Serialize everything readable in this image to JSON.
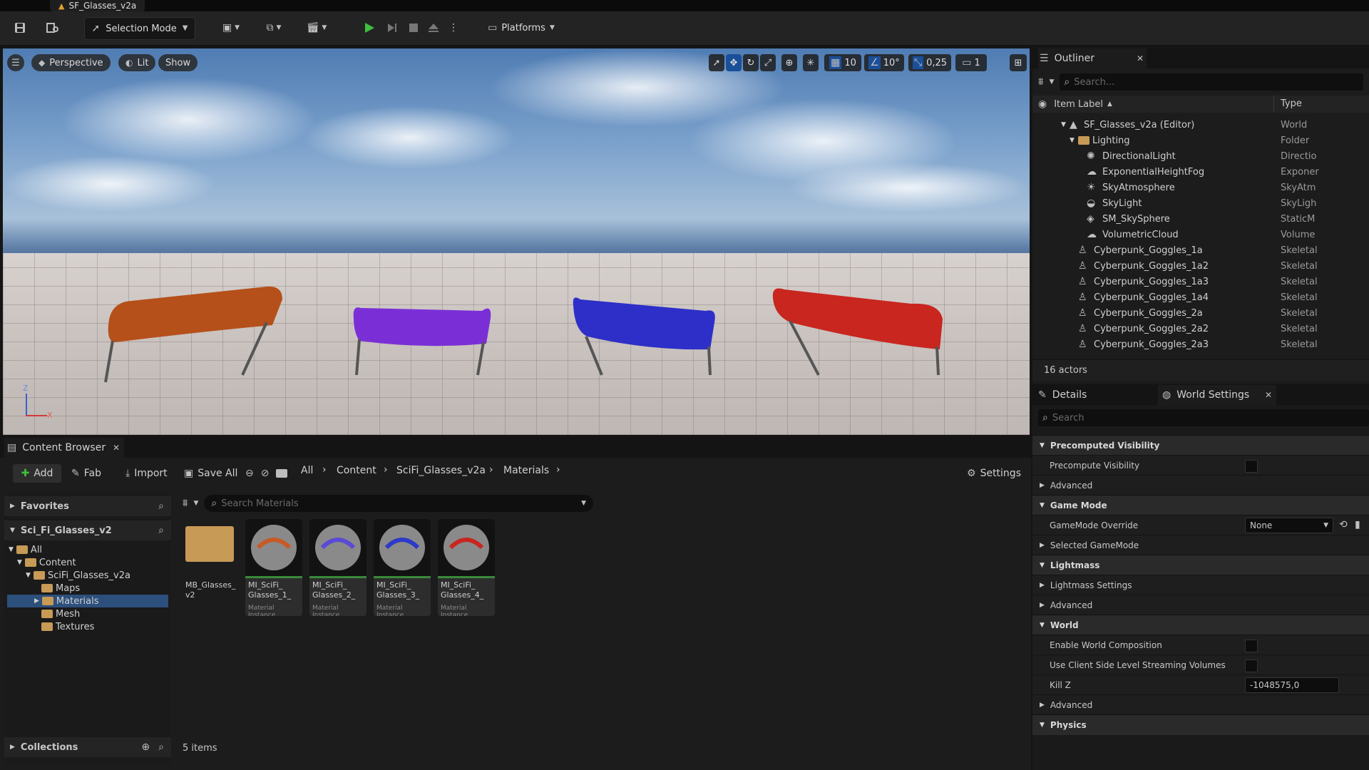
{
  "document": {
    "tab_title": "SF_Glasses_v2a"
  },
  "toolbar": {
    "mode_label": "Selection Mode",
    "platforms_label": "Platforms"
  },
  "viewport": {
    "perspective_label": "Perspective",
    "lit_label": "Lit",
    "show_label": "Show",
    "grid_snap": "10",
    "rotation_snap": "10°",
    "scale_snap": "0,25",
    "camera_speed": "1",
    "axis_z": "Z",
    "axis_x": "X",
    "glasses_colors": [
      "#b5501a",
      "#7a2fd6",
      "#2d2fc8",
      "#c8261f"
    ]
  },
  "outliner": {
    "tab_label": "Outliner",
    "search_placeholder": "Search...",
    "col_label": "Item Label",
    "col_type": "Type",
    "rows": [
      {
        "label": "SF_Glasses_v2a (Editor)",
        "type": "World"
      },
      {
        "label": "Lighting",
        "type": "Folder"
      },
      {
        "label": "DirectionalLight",
        "type": "Directio"
      },
      {
        "label": "ExponentialHeightFog",
        "type": "Exponer"
      },
      {
        "label": "SkyAtmosphere",
        "type": "SkyAtm"
      },
      {
        "label": "SkyLight",
        "type": "SkyLigh"
      },
      {
        "label": "SM_SkySphere",
        "type": "StaticM"
      },
      {
        "label": "VolumetricCloud",
        "type": "Volume"
      },
      {
        "label": "Cyberpunk_Goggles_1a",
        "type": "Skeletal"
      },
      {
        "label": "Cyberpunk_Goggles_1a2",
        "type": "Skeletal"
      },
      {
        "label": "Cyberpunk_Goggles_1a3",
        "type": "Skeletal"
      },
      {
        "label": "Cyberpunk_Goggles_1a4",
        "type": "Skeletal"
      },
      {
        "label": "Cyberpunk_Goggles_2a",
        "type": "Skeletal"
      },
      {
        "label": "Cyberpunk_Goggles_2a2",
        "type": "Skeletal"
      },
      {
        "label": "Cyberpunk_Goggles_2a3",
        "type": "Skeletal"
      }
    ],
    "actor_count": "16 actors"
  },
  "details": {
    "tab_details": "Details",
    "tab_world_settings": "World Settings",
    "search_placeholder": "Search",
    "sec_precomputed": "Precomputed Visibility",
    "precompute_visibility": "Precompute Visibility",
    "advanced_1": "Advanced",
    "sec_game_mode": "Game Mode",
    "gamemode_override": "GameMode Override",
    "gamemode_value": "None",
    "selected_gamemode": "Selected GameMode",
    "sec_lightmass": "Lightmass",
    "lightmass_settings": "Lightmass Settings",
    "advanced_2": "Advanced",
    "sec_world": "World",
    "enable_world_composition": "Enable World Composition",
    "client_side_streaming": "Use Client Side Level Streaming Volumes",
    "kill_z": "Kill Z",
    "kill_z_value": "-1048575,0",
    "advanced_3": "Advanced",
    "sec_physics": "Physics"
  },
  "content_browser": {
    "tab_label": "Content Browser",
    "add_label": "Add",
    "fab_label": "Fab",
    "import_label": "Import",
    "save_all_label": "Save All",
    "breadcrumbs": [
      "All",
      "Content",
      "SciFi_Glasses_v2a",
      "Materials"
    ],
    "settings_label": "Settings",
    "favorites_label": "Favorites",
    "project_label": "Sci_Fi_Glasses_v2",
    "search_placeholder": "Search Materials",
    "tree": [
      "All",
      "Content",
      "SciFi_Glasses_v2a",
      "Maps",
      "Materials",
      "Mesh",
      "Textures"
    ],
    "collections_label": "Collections",
    "items_count": "5 items",
    "assets": [
      {
        "name1": "MB_Glasses_",
        "name2": "v2",
        "type": ""
      },
      {
        "name1": "MI_SciFi_",
        "name2": "Glasses_1_",
        "type": "Material Instance"
      },
      {
        "name1": "MI_SciFi_",
        "name2": "Glasses_2_",
        "type": "Material Instance"
      },
      {
        "name1": "MI_SciFi_",
        "name2": "Glasses_3_",
        "type": "Material Instance"
      },
      {
        "name1": "MI_SciFi_",
        "name2": "Glasses_4_",
        "type": "Material Instance"
      }
    ]
  }
}
